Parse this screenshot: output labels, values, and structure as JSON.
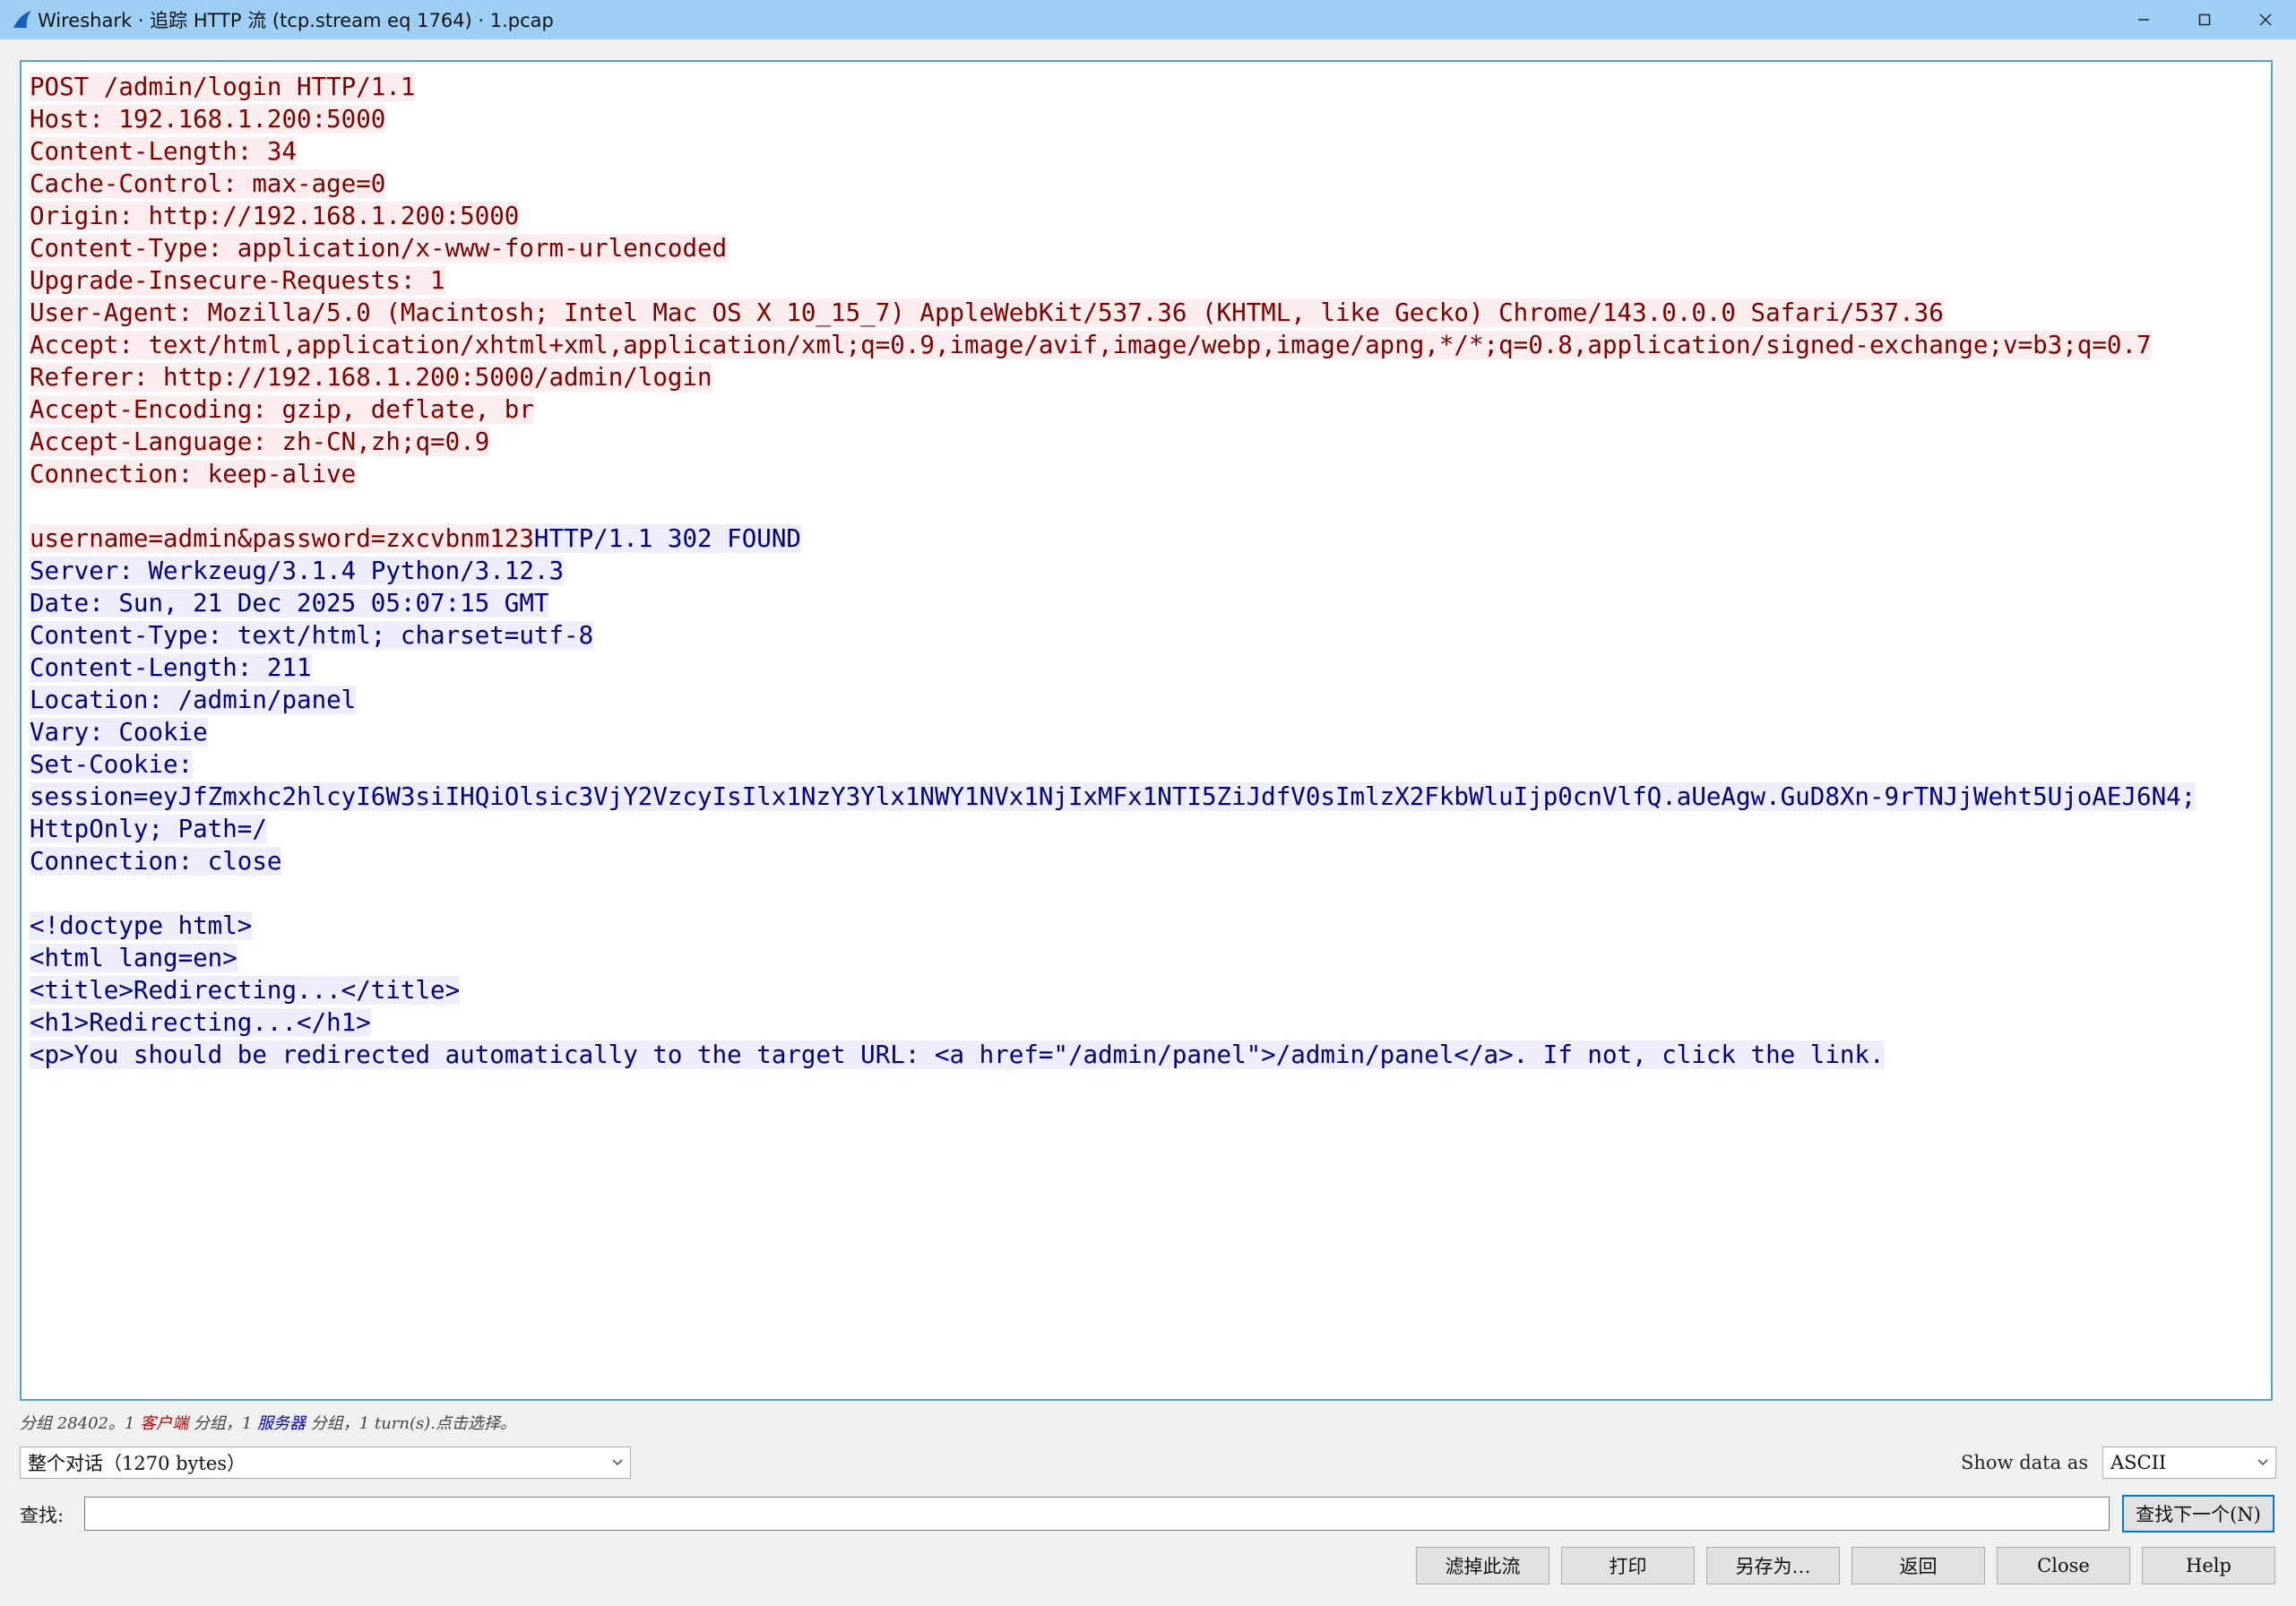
{
  "window": {
    "title": "Wireshark · 追踪 HTTP 流 (tcp.stream eq 1764) · 1.pcap",
    "icon": "wireshark-fin-icon",
    "controls": [
      "minimize-icon",
      "maximize-icon",
      "close-icon"
    ]
  },
  "colors": {
    "titlebar": "#9ccff3",
    "client_text": "#7f0000",
    "client_bg": "#fbeded",
    "server_text": "#00007f",
    "server_bg": "#ededfb"
  },
  "stream": {
    "lines": [
      [
        {
          "t": "POST /admin/login HTTP/1.1",
          "who": "client"
        }
      ],
      [
        {
          "t": "Host: 192.168.1.200:5000",
          "who": "client"
        }
      ],
      [
        {
          "t": "Content-Length: 34",
          "who": "client"
        }
      ],
      [
        {
          "t": "Cache-Control: max-age=0",
          "who": "client"
        }
      ],
      [
        {
          "t": "Origin: http://192.168.1.200:5000",
          "who": "client"
        }
      ],
      [
        {
          "t": "Content-Type: application/x-www-form-urlencoded",
          "who": "client"
        }
      ],
      [
        {
          "t": "Upgrade-Insecure-Requests: 1",
          "who": "client"
        }
      ],
      [
        {
          "t": "User-Agent: Mozilla/5.0 (Macintosh; Intel Mac OS X 10_15_7) AppleWebKit/537.36 (KHTML, like Gecko) Chrome/143.0.0.0 Safari/537.36",
          "who": "client"
        }
      ],
      [
        {
          "t": "Accept: text/html,application/xhtml+xml,application/xml;q=0.9,image/avif,image/webp,image/apng,*/*;q=0.8,application/signed-exchange;v=b3;q=0.7",
          "who": "client"
        }
      ],
      [
        {
          "t": "Referer: http://192.168.1.200:5000/admin/login",
          "who": "client"
        }
      ],
      [
        {
          "t": "Accept-Encoding: gzip, deflate, br",
          "who": "client"
        }
      ],
      [
        {
          "t": "Accept-Language: zh-CN,zh;q=0.9",
          "who": "client"
        }
      ],
      [
        {
          "t": "Connection: keep-alive",
          "who": "client"
        }
      ],
      [],
      [
        {
          "t": "username=admin&password=zxcvbnm123",
          "who": "client"
        },
        {
          "t": "HTTP/1.1 302 FOUND",
          "who": "server"
        }
      ],
      [
        {
          "t": "Server: Werkzeug/3.1.4 Python/3.12.3",
          "who": "server"
        }
      ],
      [
        {
          "t": "Date: Sun, 21 Dec 2025 05:07:15 GMT",
          "who": "server"
        }
      ],
      [
        {
          "t": "Content-Type: text/html; charset=utf-8",
          "who": "server"
        }
      ],
      [
        {
          "t": "Content-Length: 211",
          "who": "server"
        }
      ],
      [
        {
          "t": "Location: /admin/panel",
          "who": "server"
        }
      ],
      [
        {
          "t": "Vary: Cookie",
          "who": "server"
        }
      ],
      [
        {
          "t": "Set-Cookie:",
          "who": "server"
        }
      ],
      [
        {
          "t": "session=eyJfZmxhc2hlcyI6W3siIHQiOlsic3VjY2VzcyIsIlx1NzY3Ylx1NWY1NVx1NjIxMFx1NTI5ZiJdfV0sImlzX2FkbWluIjp0cnVlfQ.aUeAgw.GuD8Xn-9rTNJjWeht5UjoAEJ6N4;",
          "who": "server"
        }
      ],
      [
        {
          "t": "HttpOnly; Path=/",
          "who": "server"
        }
      ],
      [
        {
          "t": "Connection: close",
          "who": "server"
        }
      ],
      [],
      [
        {
          "t": "<!doctype html>",
          "who": "server"
        }
      ],
      [
        {
          "t": "<html lang=en>",
          "who": "server"
        }
      ],
      [
        {
          "t": "<title>Redirecting...</title>",
          "who": "server"
        }
      ],
      [
        {
          "t": "<h1>Redirecting...</h1>",
          "who": "server"
        }
      ],
      [
        {
          "t": "<p>You should be redirected automatically to the target URL: <a href=\"/admin/panel\">/admin/panel</a>. If not, click the link.",
          "who": "server"
        }
      ]
    ]
  },
  "status": {
    "prefix": "分组 28402。1 ",
    "client_word": "客户端",
    "middle": " 分组，1 ",
    "server_word": "服务器",
    "suffix": " 分组，1 turn(s).点击选择。"
  },
  "conversation_select": {
    "value": "整个对话（1270 bytes）"
  },
  "show_data": {
    "label": "Show data as",
    "value": "ASCII"
  },
  "find": {
    "label": "查找:",
    "value": "",
    "button": "查找下一个(N)"
  },
  "buttons": {
    "filter_out": "滤掉此流",
    "print": "打印",
    "save_as": "另存为…",
    "back": "返回",
    "close": "Close",
    "help": "Help"
  }
}
